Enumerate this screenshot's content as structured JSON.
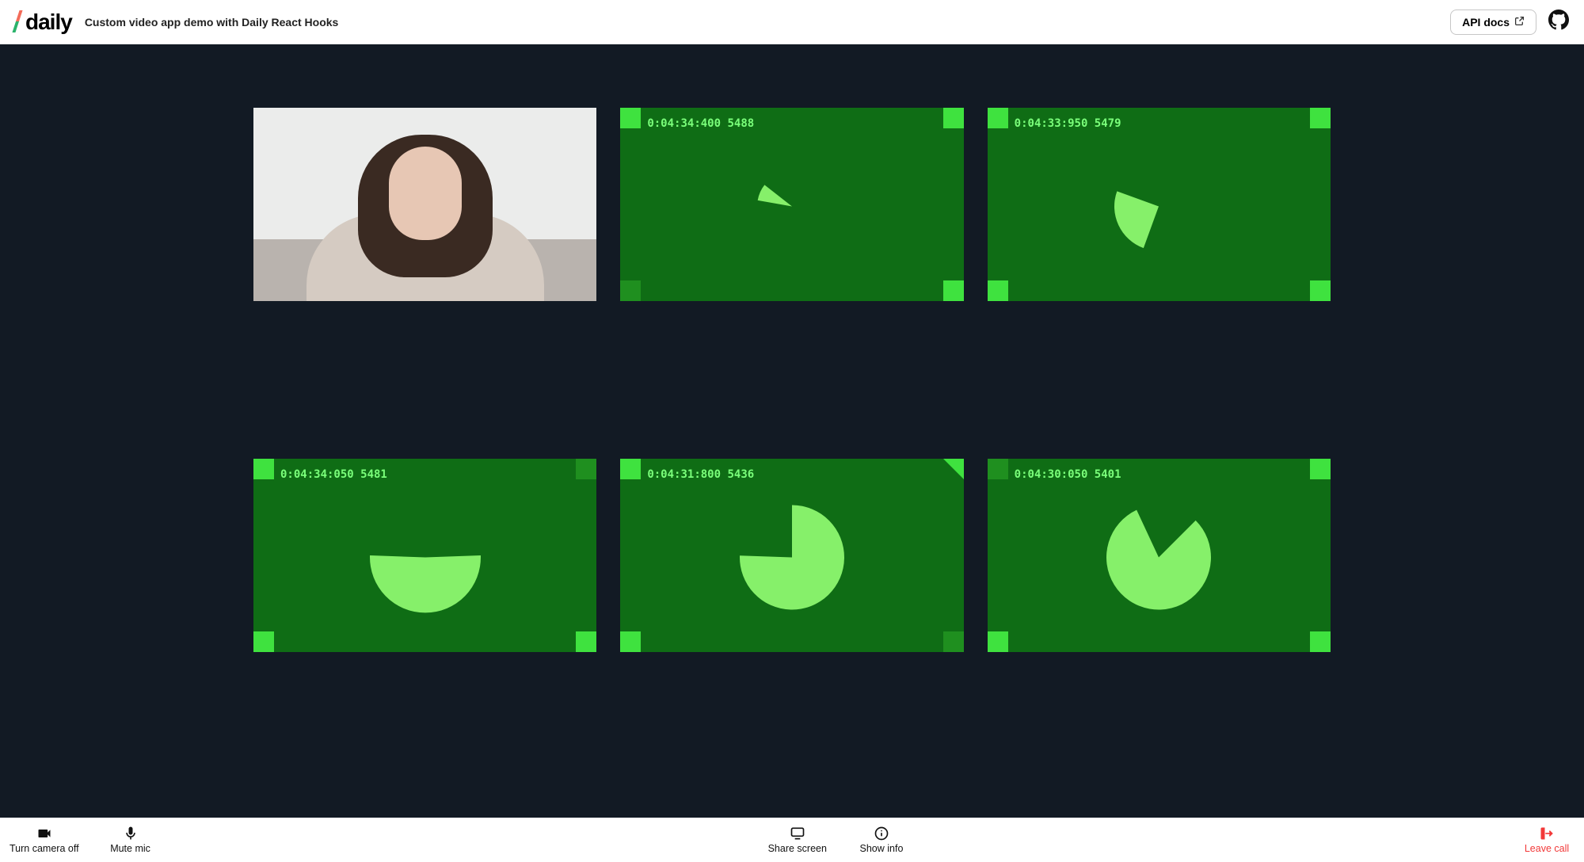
{
  "header": {
    "logo_text": "daily",
    "subtitle": "Custom video app demo with Daily React Hooks",
    "api_docs_label": "API docs"
  },
  "tiles": [
    {
      "kind": "camera"
    },
    {
      "kind": "synth",
      "timestamp": "0:04:34:400 5488",
      "pie": {
        "r": 44,
        "start_deg": 280,
        "sweep_deg": 28
      },
      "corners": {
        "tl": "bright",
        "tr": "bright",
        "bl": "dim",
        "br": "bright"
      }
    },
    {
      "kind": "synth",
      "timestamp": "0:04:33:950 5479",
      "pie": {
        "r": 56,
        "start_deg": 200,
        "sweep_deg": 90
      },
      "corners": {
        "tl": "bright",
        "tr": "bright",
        "bl": "bright",
        "br": "bright"
      }
    },
    {
      "kind": "synth",
      "timestamp": "0:04:34:050 5481",
      "pie": {
        "r": 70,
        "start_deg": 88,
        "sweep_deg": 184
      },
      "corners": {
        "tl": "bright",
        "tr": "dim",
        "bl": "bright",
        "br": "bright"
      }
    },
    {
      "kind": "synth",
      "timestamp": "0:04:31:800 5436",
      "pie": {
        "r": 66,
        "start_deg": 0,
        "sweep_deg": 272
      },
      "corners": {
        "tl": "bright",
        "tr": "tri",
        "bl": "bright",
        "br": "dim"
      }
    },
    {
      "kind": "synth",
      "timestamp": "0:04:30:050 5401",
      "pie": {
        "r": 66,
        "start_deg": 45,
        "sweep_deg": 290
      },
      "corners": {
        "tl": "dim",
        "tr": "bright",
        "bl": "bright",
        "br": "bright"
      }
    }
  ],
  "tray": {
    "camera_label": "Turn camera off",
    "mic_label": "Mute mic",
    "share_label": "Share screen",
    "info_label": "Show info",
    "leave_label": "Leave call"
  },
  "colors": {
    "stage_bg": "#121a24",
    "tile_bg": "#0f6d15",
    "accent": "#3fe23f",
    "accent_dim": "#1f8f1f",
    "pie_fill": "#86f06a",
    "leave_red": "#f23939"
  }
}
